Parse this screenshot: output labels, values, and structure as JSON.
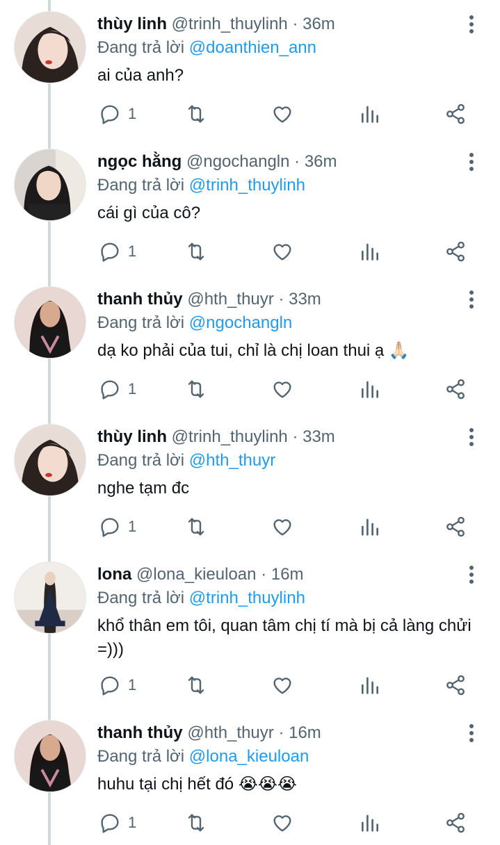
{
  "labels": {
    "replying_to": "Đang trả lời"
  },
  "colors": {
    "mention": "#1d9bf0",
    "muted": "#536471",
    "text": "#0f1419",
    "thread_line": "#cfd9de"
  },
  "icons": [
    "reply-icon",
    "retweet-icon",
    "like-icon",
    "analytics-icon",
    "share-icon",
    "more-icon"
  ],
  "tweets": [
    {
      "name": "thùy linh",
      "handle": "@trinh_thuylinh",
      "time": "· 36m",
      "reply_to": "@doanthien_ann",
      "text": "ai của anh?",
      "reply_count": "1"
    },
    {
      "name": "ngọc hằng",
      "handle": "@ngochangln",
      "time": "· 36m",
      "reply_to": "@trinh_thuylinh",
      "text": "cái gì của cô?",
      "reply_count": "1"
    },
    {
      "name": "thanh thủy",
      "handle": "@hth_thuyr",
      "time": "· 33m",
      "reply_to": "@ngochangln",
      "text": "dạ ko phải của tui, chỉ là chị loan thui ạ 🙏🏻",
      "reply_count": "1"
    },
    {
      "name": "thùy linh",
      "handle": "@trinh_thuylinh",
      "time": "· 33m",
      "reply_to": "@hth_thuyr",
      "text": "nghe tạm đc",
      "reply_count": "1"
    },
    {
      "name": "lona",
      "handle": "@lona_kieuloan",
      "time": "· 16m",
      "reply_to": "@trinh_thuylinh",
      "text": "khổ thân em tôi, quan tâm chị tí mà bị cả làng chửi =)))",
      "reply_count": "1"
    },
    {
      "name": "thanh thủy",
      "handle": "@hth_thuyr",
      "time": "· 16m",
      "reply_to": "@lona_kieuloan",
      "text": "huhu tại chị hết đó 😭😭😭",
      "reply_count": "1"
    }
  ]
}
